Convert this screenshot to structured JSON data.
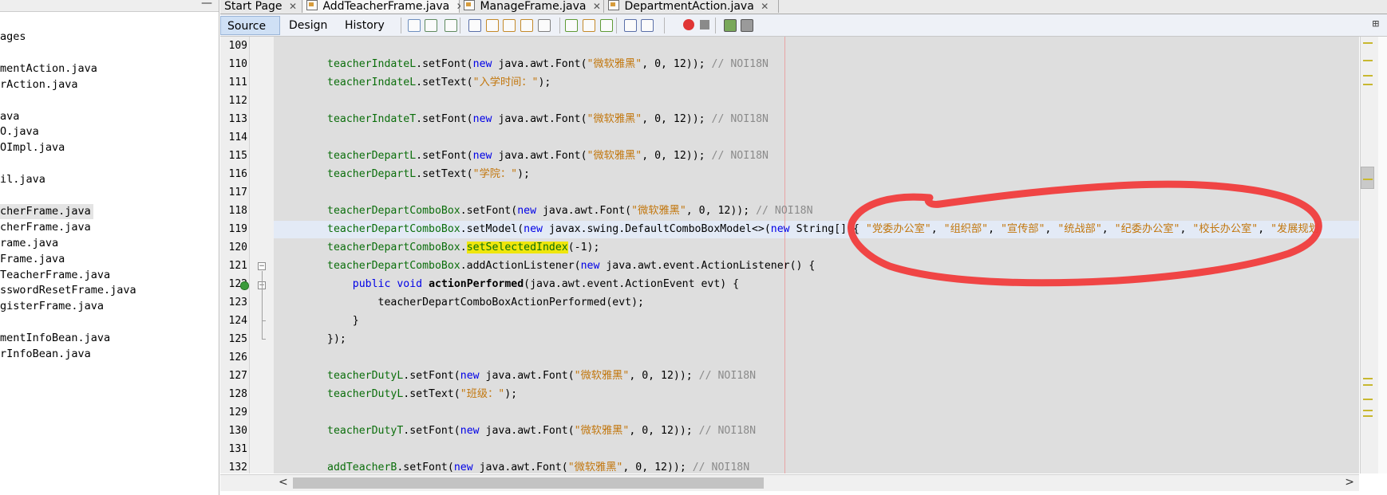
{
  "project_tree": {
    "items": [
      {
        "label": "ages"
      },
      {
        "label": ""
      },
      {
        "label": "mentAction.java"
      },
      {
        "label": "rAction.java"
      },
      {
        "label": ""
      },
      {
        "label": "ava"
      },
      {
        "label": "O.java"
      },
      {
        "label": "OImpl.java"
      },
      {
        "label": ""
      },
      {
        "label": "il.java"
      },
      {
        "label": ""
      },
      {
        "label": "cherFrame.java",
        "selected": true
      },
      {
        "label": "cherFrame.java"
      },
      {
        "label": "rame.java"
      },
      {
        "label": "Frame.java"
      },
      {
        "label": "TeacherFrame.java"
      },
      {
        "label": "sswordResetFrame.java"
      },
      {
        "label": "gisterFrame.java"
      },
      {
        "label": ""
      },
      {
        "label": "mentInfoBean.java"
      },
      {
        "label": "rInfoBean.java"
      }
    ]
  },
  "tabs": [
    {
      "label": "Start Page",
      "icon": "start-page-icon",
      "active": false
    },
    {
      "label": "AddTeacherFrame.java",
      "icon": "java-file-icon",
      "active": true
    },
    {
      "label": "ManageFrame.java",
      "icon": "java-file-icon",
      "active": false
    },
    {
      "label": "DepartmentAction.java",
      "icon": "java-file-icon",
      "active": false
    }
  ],
  "view_tabs": [
    {
      "label": "Source",
      "active": true
    },
    {
      "label": "Design",
      "active": false
    },
    {
      "label": "History",
      "active": false
    }
  ],
  "toolbar_icons": [
    "last-edit-icon",
    "back-icon",
    "forward-icon",
    "find-icon",
    "find-previous-icon",
    "find-next-icon",
    "toggle-highlight-icon",
    "toggle-rectangular-selection-icon",
    "previous-bookmark-icon",
    "next-bookmark-icon",
    "toggle-bookmark-icon",
    "shift-left-icon",
    "shift-right-icon",
    "start-macro-icon",
    "stop-macro-icon",
    "comment-icon",
    "uncomment-icon"
  ],
  "line_numbers": [
    "109",
    "110",
    "111",
    "112",
    "113",
    "114",
    "115",
    "116",
    "117",
    "118",
    "119",
    "120",
    "121",
    "122",
    "123",
    "124",
    "125",
    "126",
    "127",
    "128",
    "129",
    "130",
    "131",
    "132"
  ],
  "code_lines": [
    [],
    [
      [
        "f",
        "teacherIndateL"
      ],
      [
        "p",
        ".setFont("
      ],
      [
        "k",
        "new"
      ],
      [
        "p",
        " java.awt.Font("
      ],
      [
        "s",
        "\"微软雅黑\""
      ],
      [
        "p",
        ", 0, 12)); "
      ],
      [
        "c",
        "// NOI18N"
      ]
    ],
    [
      [
        "f",
        "teacherIndateL"
      ],
      [
        "p",
        ".setText("
      ],
      [
        "s",
        "\"入学时间：\""
      ],
      [
        "p",
        ");"
      ]
    ],
    [],
    [
      [
        "f",
        "teacherIndateT"
      ],
      [
        "p",
        ".setFont("
      ],
      [
        "k",
        "new"
      ],
      [
        "p",
        " java.awt.Font("
      ],
      [
        "s",
        "\"微软雅黑\""
      ],
      [
        "p",
        ", 0, 12)); "
      ],
      [
        "c",
        "// NOI18N"
      ]
    ],
    [],
    [
      [
        "f",
        "teacherDepartL"
      ],
      [
        "p",
        ".setFont("
      ],
      [
        "k",
        "new"
      ],
      [
        "p",
        " java.awt.Font("
      ],
      [
        "s",
        "\"微软雅黑\""
      ],
      [
        "p",
        ", 0, 12)); "
      ],
      [
        "c",
        "// NOI18N"
      ]
    ],
    [
      [
        "f",
        "teacherDepartL"
      ],
      [
        "p",
        ".setText("
      ],
      [
        "s",
        "\"学院：\""
      ],
      [
        "p",
        ");"
      ]
    ],
    [],
    [
      [
        "f",
        "teacherDepartComboBox"
      ],
      [
        "p",
        ".setFont("
      ],
      [
        "k",
        "new"
      ],
      [
        "p",
        " java.awt.Font("
      ],
      [
        "s",
        "\"微软雅黑\""
      ],
      [
        "p",
        ", 0, 12)); "
      ],
      [
        "c",
        "// NOI18N"
      ]
    ],
    [
      [
        "f",
        "teacherDepartComboBox"
      ],
      [
        "p",
        ".setModel("
      ],
      [
        "k",
        "new"
      ],
      [
        "p",
        " javax.swing.DefaultComboBoxModel<>("
      ],
      [
        "k",
        "new"
      ],
      [
        "p",
        " String[] { "
      ],
      [
        "s",
        "\"党委办公室\""
      ],
      [
        "p",
        ", "
      ],
      [
        "s",
        "\"组织部\""
      ],
      [
        "p",
        ", "
      ],
      [
        "s",
        "\"宣传部\""
      ],
      [
        "p",
        ", "
      ],
      [
        "s",
        "\"统战部\""
      ],
      [
        "p",
        ", "
      ],
      [
        "s",
        "\"纪委办公室\""
      ],
      [
        "p",
        ", "
      ],
      [
        "s",
        "\"校长办公室\""
      ],
      [
        "p",
        ", "
      ],
      [
        "s",
        "\"发展规划"
      ]
    ],
    [
      [
        "f",
        "teacherDepartComboBox"
      ],
      [
        "p",
        "."
      ],
      [
        "h",
        "setSelectedIndex"
      ],
      [
        "p",
        "(-1);"
      ]
    ],
    [
      [
        "f",
        "teacherDepartComboBox"
      ],
      [
        "p",
        ".addActionListener("
      ],
      [
        "k",
        "new"
      ],
      [
        "p",
        " java.awt.event.ActionListener() {"
      ]
    ],
    [
      [
        "p",
        "    "
      ],
      [
        "k",
        "public void"
      ],
      [
        "p",
        " "
      ],
      [
        "m",
        "actionPerformed"
      ],
      [
        "p",
        "(java.awt.event.ActionEvent evt) {"
      ]
    ],
    [
      [
        "p",
        "        teacherDepartComboBoxActionPerformed(evt);"
      ]
    ],
    [
      [
        "p",
        "    }"
      ]
    ],
    [
      [
        "p",
        "});"
      ]
    ],
    [],
    [
      [
        "f",
        "teacherDutyL"
      ],
      [
        "p",
        ".setFont("
      ],
      [
        "k",
        "new"
      ],
      [
        "p",
        " java.awt.Font("
      ],
      [
        "s",
        "\"微软雅黑\""
      ],
      [
        "p",
        ", 0, 12)); "
      ],
      [
        "c",
        "// NOI18N"
      ]
    ],
    [
      [
        "f",
        "teacherDutyL"
      ],
      [
        "p",
        ".setText("
      ],
      [
        "s",
        "\"班级：\""
      ],
      [
        "p",
        ");"
      ]
    ],
    [],
    [
      [
        "f",
        "teacherDutyT"
      ],
      [
        "p",
        ".setFont("
      ],
      [
        "k",
        "new"
      ],
      [
        "p",
        " java.awt.Font("
      ],
      [
        "s",
        "\"微软雅黑\""
      ],
      [
        "p",
        ", 0, 12)); "
      ],
      [
        "c",
        "// NOI18N"
      ]
    ],
    [],
    [
      [
        "f",
        "addTeacherB"
      ],
      [
        "p",
        ".setFont("
      ],
      [
        "k",
        "new"
      ],
      [
        "p",
        " java.awt.Font("
      ],
      [
        "s",
        "\"微软雅黑\""
      ],
      [
        "p",
        ", 0, 12)); "
      ],
      [
        "c",
        "// NOI18N"
      ]
    ]
  ],
  "colors": {
    "field": "#0b6e0b",
    "keyword": "#0000e6",
    "string": "#c2770e",
    "comment": "#8b8b8b",
    "annotation_red": "#f03c3c",
    "current_line": "#e3eaf6",
    "search_highlight": "#efe60c"
  },
  "icons": {
    "minimize": "minimize-icon",
    "split_editor": "split-editor-icon",
    "scroll_left": "scroll-left-icon",
    "scroll_right": "scroll-right-icon"
  },
  "glyphs": {
    "minimize": "—",
    "split": "⊞",
    "left": "<",
    "right": ">",
    "close": "✕",
    "fold_open": "−"
  }
}
